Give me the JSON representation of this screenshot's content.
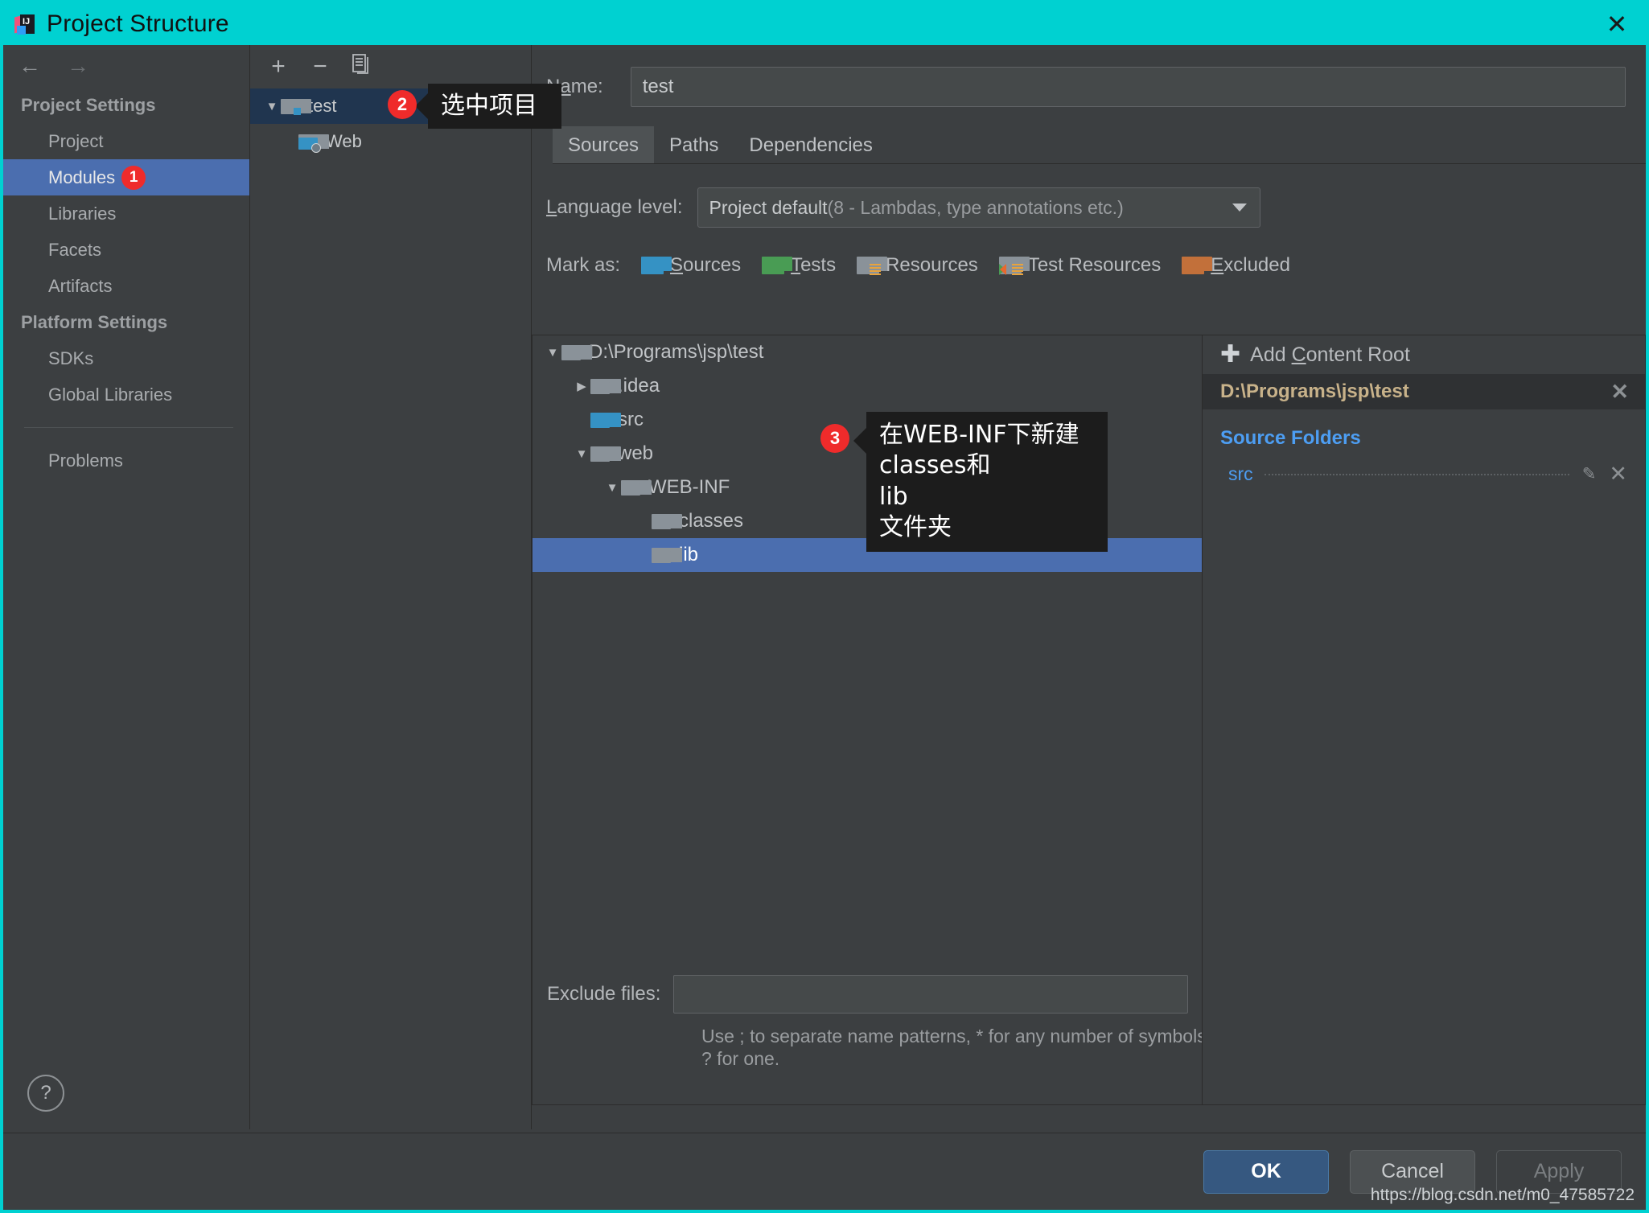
{
  "window": {
    "title": "Project Structure",
    "app_icon": "intellij-idea-icon",
    "close_label": "✕"
  },
  "nav": {
    "back_icon": "arrow-left-icon",
    "forward_icon": "arrow-right-icon"
  },
  "sidebar": {
    "groups": [
      {
        "label": "Project Settings",
        "items": [
          {
            "label": "Project",
            "selected": false,
            "badge": null
          },
          {
            "label": "Modules",
            "selected": true,
            "badge": "1"
          },
          {
            "label": "Libraries",
            "selected": false,
            "badge": null
          },
          {
            "label": "Facets",
            "selected": false,
            "badge": null
          },
          {
            "label": "Artifacts",
            "selected": false,
            "badge": null
          }
        ]
      },
      {
        "label": "Platform Settings",
        "items": [
          {
            "label": "SDKs",
            "selected": false,
            "badge": null
          },
          {
            "label": "Global Libraries",
            "selected": false,
            "badge": null
          }
        ]
      }
    ],
    "problems_label": "Problems",
    "help_label": "?"
  },
  "module_tree": {
    "toolbar": {
      "add": "+",
      "remove": "−",
      "copy": "copy-icon"
    },
    "nodes": [
      {
        "label": "test",
        "expanded": true,
        "selected": true,
        "icon": "module-folder-icon",
        "badge": "2",
        "depth": 0
      },
      {
        "label": "Web",
        "expanded": false,
        "selected": false,
        "icon": "web-facet-icon",
        "badge": null,
        "depth": 1
      }
    ]
  },
  "main": {
    "name_label": "Name:",
    "name_value": "test",
    "tabs": [
      {
        "label": "Sources",
        "active": true
      },
      {
        "label": "Paths",
        "active": false
      },
      {
        "label": "Dependencies",
        "active": false
      }
    ],
    "language_level_label": "Language level:",
    "language_level_value": "Project default ",
    "language_level_detail": "(8 - Lambdas, type annotations etc.)",
    "mark_as_label": "Mark as:",
    "mark_as_options": [
      {
        "label": "Sources",
        "color": "#3592c4",
        "icon_kind": "sources"
      },
      {
        "label": "Tests",
        "color": "#499c54",
        "icon_kind": "tests"
      },
      {
        "label": "Resources",
        "color": "#8a9299",
        "icon_kind": "res"
      },
      {
        "label": "Test Resources",
        "color": "#8a9299",
        "icon_kind": "tres"
      },
      {
        "label": "Excluded",
        "color": "#c2703a",
        "icon_kind": "excl"
      }
    ],
    "file_tree": [
      {
        "label": "D:\\Programs\\jsp\\test",
        "depth": 0,
        "expander": "down",
        "folder": "grey",
        "selected": false
      },
      {
        "label": ".idea",
        "depth": 1,
        "expander": "right",
        "folder": "grey",
        "selected": false
      },
      {
        "label": "src",
        "depth": 1,
        "expander": "none",
        "folder": "blue",
        "selected": false
      },
      {
        "label": "web",
        "depth": 1,
        "expander": "down",
        "folder": "grey",
        "selected": false
      },
      {
        "label": "WEB-INF",
        "depth": 2,
        "expander": "down",
        "folder": "grey",
        "selected": false
      },
      {
        "label": "classes",
        "depth": 3,
        "expander": "none",
        "folder": "grey",
        "selected": false
      },
      {
        "label": "lib",
        "depth": 3,
        "expander": "none",
        "folder": "grey",
        "selected": true
      }
    ],
    "exclude_files_label": "Exclude files:",
    "exclude_files_value": "",
    "exclude_hint": "Use ; to separate name patterns, * for any number of symbols, ? for one."
  },
  "content_roots": {
    "add_label": "Add Content Root",
    "add_icon": "plus-icon",
    "root_path": "D:\\Programs\\jsp\\test",
    "root_close_icon": "✕",
    "source_folders_title": "Source Folders",
    "folders": [
      {
        "name": "src",
        "edit_icon": "pencil-icon",
        "remove_icon": "✕"
      }
    ]
  },
  "footer": {
    "ok_label": "OK",
    "cancel_label": "Cancel",
    "apply_label": "Apply",
    "watermark": "https://blog.csdn.net/m0_47585722"
  },
  "callouts": [
    {
      "id": "step2",
      "number": "2",
      "text": "选中项目"
    },
    {
      "id": "step3",
      "number": "3",
      "text": "在WEB-INF下新建\nclasses和\nlib\n文件夹"
    }
  ],
  "colors": {
    "titlebar": "#00d1d1",
    "accent_selection": "#4b6eaf",
    "badge_red": "#ef2b2b",
    "link_blue": "#4d9ef3",
    "path_gold": "#c8b28a"
  }
}
